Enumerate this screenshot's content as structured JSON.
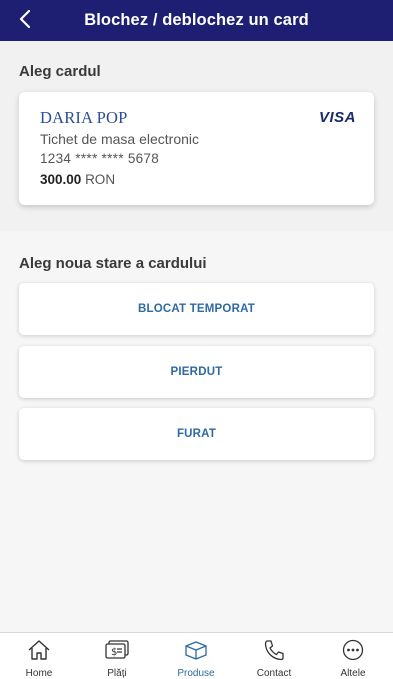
{
  "header": {
    "title": "Blochez / deblochez un card",
    "back_icon": "chevron-left-icon"
  },
  "card_section": {
    "title": "Aleg cardul",
    "card": {
      "holder": "DARIA POP",
      "brand": "VISA",
      "type": "Tichet de masa electronic",
      "number": "1234 **** **** 5678",
      "amount": "300.00",
      "currency": "RON"
    }
  },
  "state_section": {
    "title": "Aleg noua stare a cardului",
    "options": [
      {
        "label": "BLOCAT TEMPORAT"
      },
      {
        "label": "PIERDUT"
      },
      {
        "label": "FURAT"
      }
    ]
  },
  "tabbar": {
    "active_tab": "Produse",
    "tabs": [
      {
        "label": "Home",
        "icon": "home-icon"
      },
      {
        "label": "Plăți",
        "icon": "payments-icon"
      },
      {
        "label": "Produse",
        "icon": "box-icon"
      },
      {
        "label": "Contact",
        "icon": "phone-icon"
      },
      {
        "label": "Altele",
        "icon": "more-icon"
      }
    ]
  },
  "colors": {
    "header_bg": "#1e1f72",
    "accent": "#2d6aa6",
    "card_holder": "#2b4e9a"
  }
}
